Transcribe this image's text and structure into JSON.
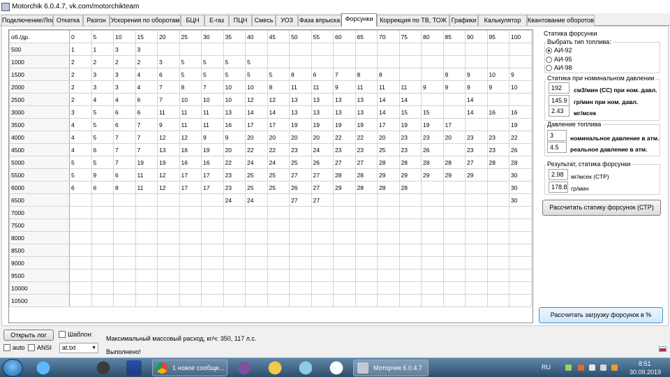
{
  "window": {
    "title": "Motorchik 6.0.4.7, vk.com/motorchikteam"
  },
  "tabs": [
    "Подключение/Лог",
    "Откатка",
    "Разгон",
    "Ускорения по оборотам",
    "БЦН",
    "Е-газ",
    "ПЦН",
    "Смесь",
    "УОЗ",
    "Фаза впрыска",
    "Форсунки",
    "Коррекция по ТВ, ТОЖ",
    "Графики",
    "Калькулятор",
    "Квантование оборотов"
  ],
  "active_tab": "Форсунки",
  "grid": {
    "corner": "об./др.",
    "columns": [
      "0",
      "5",
      "10",
      "15",
      "20",
      "25",
      "30",
      "35",
      "40",
      "45",
      "50",
      "55",
      "60",
      "65",
      "70",
      "75",
      "80",
      "85",
      "90",
      "95",
      "100"
    ],
    "rows": [
      {
        "rpm": "500",
        "cells": [
          "1",
          "1",
          "3",
          "3",
          "",
          "",
          "",
          "",
          "",
          "",
          "",
          "",
          "",
          "",
          "",
          "",
          "",
          "",
          "",
          "",
          ""
        ]
      },
      {
        "rpm": "1000",
        "cells": [
          "2",
          "2",
          "2",
          "2",
          "3",
          "5",
          "5",
          "5",
          "5",
          "",
          "",
          "",
          "",
          "",
          "",
          "",
          "",
          "",
          "",
          "",
          ""
        ]
      },
      {
        "rpm": "1500",
        "cells": [
          "2",
          "3",
          "3",
          "4",
          "6",
          "5",
          "5",
          "5",
          "5",
          "5",
          "8",
          "6",
          "7",
          "8",
          "8",
          "",
          "",
          "9",
          "9",
          "10",
          "9"
        ]
      },
      {
        "rpm": "2000",
        "cells": [
          "2",
          "3",
          "3",
          "4",
          "7",
          "8",
          "7",
          "10",
          "10",
          "8",
          "11",
          "11",
          "9",
          "11",
          "11",
          "11",
          "9",
          "9",
          "9",
          "9",
          "10"
        ]
      },
      {
        "rpm": "2500",
        "cells": [
          "2",
          "4",
          "4",
          "6",
          "7",
          "10",
          "10",
          "10",
          "12",
          "12",
          "13",
          "13",
          "13",
          "13",
          "14",
          "14",
          "",
          "",
          "14",
          "",
          ""
        ]
      },
      {
        "rpm": "3000",
        "cells": [
          "3",
          "5",
          "6",
          "6",
          "11",
          "11",
          "11",
          "13",
          "14",
          "14",
          "13",
          "13",
          "13",
          "13",
          "14",
          "15",
          "15",
          "",
          "14",
          "16",
          "16"
        ]
      },
      {
        "rpm": "3500",
        "cells": [
          "4",
          "5",
          "6",
          "7",
          "9",
          "11",
          "11",
          "16",
          "17",
          "17",
          "19",
          "19",
          "19",
          "19",
          "17",
          "19",
          "19",
          "17",
          "",
          "",
          "19"
        ]
      },
      {
        "rpm": "4000",
        "cells": [
          "4",
          "5",
          "7",
          "7",
          "12",
          "12",
          "9",
          "9",
          "20",
          "20",
          "20",
          "20",
          "22",
          "22",
          "20",
          "23",
          "23",
          "20",
          "23",
          "23",
          "22"
        ]
      },
      {
        "rpm": "4500",
        "cells": [
          "4",
          "6",
          "7",
          "7",
          "13",
          "16",
          "19",
          "20",
          "22",
          "22",
          "23",
          "24",
          "23",
          "23",
          "25",
          "23",
          "26",
          "",
          "23",
          "23",
          "26"
        ]
      },
      {
        "rpm": "5000",
        "cells": [
          "5",
          "5",
          "7",
          "19",
          "19",
          "16",
          "16",
          "22",
          "24",
          "24",
          "25",
          "26",
          "27",
          "27",
          "28",
          "28",
          "28",
          "28",
          "27",
          "28",
          "28"
        ]
      },
      {
        "rpm": "5500",
        "cells": [
          "5",
          "9",
          "6",
          "11",
          "12",
          "17",
          "17",
          "23",
          "25",
          "25",
          "27",
          "27",
          "28",
          "28",
          "29",
          "29",
          "29",
          "29",
          "29",
          "",
          "30"
        ]
      },
      {
        "rpm": "6000",
        "cells": [
          "6",
          "6",
          "8",
          "11",
          "12",
          "17",
          "17",
          "23",
          "25",
          "25",
          "26",
          "27",
          "29",
          "28",
          "28",
          "28",
          "",
          "",
          "",
          "",
          "30"
        ]
      },
      {
        "rpm": "6500",
        "cells": [
          "",
          "",
          "",
          "",
          "",
          "",
          "",
          "24",
          "24",
          "",
          "27",
          "27",
          "",
          "",
          "",
          "",
          "",
          "",
          "",
          "",
          "30"
        ]
      },
      {
        "rpm": "7000",
        "cells": [
          "",
          "",
          "",
          "",
          "",
          "",
          "",
          "",
          "",
          "",
          "",
          "",
          "",
          "",
          "",
          "",
          "",
          "",
          "",
          "",
          ""
        ]
      },
      {
        "rpm": "7500",
        "cells": [
          "",
          "",
          "",
          "",
          "",
          "",
          "",
          "",
          "",
          "",
          "",
          "",
          "",
          "",
          "",
          "",
          "",
          "",
          "",
          "",
          ""
        ]
      },
      {
        "rpm": "8000",
        "cells": [
          "",
          "",
          "",
          "",
          "",
          "",
          "",
          "",
          "",
          "",
          "",
          "",
          "",
          "",
          "",
          "",
          "",
          "",
          "",
          "",
          ""
        ]
      },
      {
        "rpm": "8500",
        "cells": [
          "",
          "",
          "",
          "",
          "",
          "",
          "",
          "",
          "",
          "",
          "",
          "",
          "",
          "",
          "",
          "",
          "",
          "",
          "",
          "",
          ""
        ]
      },
      {
        "rpm": "9000",
        "cells": [
          "",
          "",
          "",
          "",
          "",
          "",
          "",
          "",
          "",
          "",
          "",
          "",
          "",
          "",
          "",
          "",
          "",
          "",
          "",
          "",
          ""
        ]
      },
      {
        "rpm": "9500",
        "cells": [
          "",
          "",
          "",
          "",
          "",
          "",
          "",
          "",
          "",
          "",
          "",
          "",
          "",
          "",
          "",
          "",
          "",
          "",
          "",
          "",
          ""
        ]
      },
      {
        "rpm": "10000",
        "cells": [
          "",
          "",
          "",
          "",
          "",
          "",
          "",
          "",
          "",
          "",
          "",
          "",
          "",
          "",
          "",
          "",
          "",
          "",
          "",
          "",
          ""
        ]
      },
      {
        "rpm": "10500",
        "cells": [
          "",
          "",
          "",
          "",
          "",
          "",
          "",
          "",
          "",
          "",
          "",
          "",
          "",
          "",
          "",
          "",
          "",
          "",
          "",
          "",
          ""
        ]
      }
    ]
  },
  "side": {
    "statics_title": "Статика форсунки",
    "fuel_title": "Выбрать тип топлива:",
    "fuel_options": [
      "АИ-92",
      "АИ-95",
      "АИ-98"
    ],
    "fuel_selected": "АИ-92",
    "nominal_title": "Статика при номинальном давлении",
    "nominal": [
      {
        "value": "192",
        "label": "см3/мин (СС) при ном. давл."
      },
      {
        "value": "145.9",
        "label": "гр/мин при ном. давл."
      },
      {
        "value": "2.43",
        "label": "мг/мсек"
      }
    ],
    "pressure_title": "Давление топлива",
    "pressure": [
      {
        "value": "3",
        "label": "номинальное давление в атм."
      },
      {
        "value": "4.5",
        "label": "реальное давление в атм."
      }
    ],
    "result_title": "Результат, статика форсунки",
    "result": [
      {
        "value": "2.98",
        "label": "мг/мсек (СТР)"
      },
      {
        "value": "178.8",
        "label": "гр/мин"
      }
    ],
    "calc_static_button": "Рассчитать статику форсунок (СТР)",
    "calc_load_button": "Рассчитать загрузку форсунок в %"
  },
  "bottom": {
    "open_log_button": "Открыть лог",
    "template_label": "Шаблон:",
    "auto_label": "auto",
    "ansi_label": "ANSI",
    "file_value": "at.txt",
    "info_text": "Максимальный массовый расход, кг/ч: 350, 117 л.с.",
    "status_text": "Выполнено!"
  },
  "taskbar": {
    "chrome_label": "1 новое сообще...",
    "app_label": "Моторчик 6.0.4.7",
    "lang": "RU",
    "time": "8:51",
    "date": "30.09.2019"
  }
}
